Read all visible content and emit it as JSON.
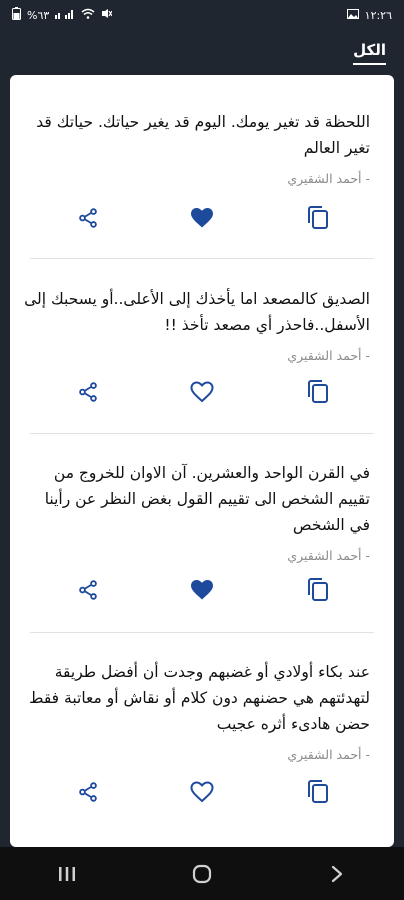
{
  "status_bar": {
    "time": "١٢:٢٦",
    "battery": "%٦٣"
  },
  "header": {
    "tab_label": "الكل"
  },
  "quotes": [
    {
      "text": "اللحظة قد تغير يومك. اليوم قد يغير حياتك. حياتك قد تغير العالم",
      "author": "- أحمد الشقيري",
      "liked": true
    },
    {
      "text": "الصديق كالمصعد اما يأخذك إلى الأعلى..أو يسحبك إلى الأسفل..فاحذر أي مصعد تأخذ !!",
      "author": "- أحمد الشقيري",
      "liked": false
    },
    {
      "text": "في القرن الواحد والعشرين. آن الاوان للخروج من تقييم الشخص الى تقييم القول بغض النظر عن رأينا في الشخص",
      "author": "- أحمد الشقيري",
      "liked": true
    },
    {
      "text": "عند بكاء أولادي أو غضبهم وجدت أن أفضل طريقة لتهدئتهم هي حضنهم دون كلام أو نقاش أو معاتبة فقط حضن هادىء أثره عجيب",
      "author": "- أحمد الشقيري",
      "liked": false
    }
  ],
  "colors": {
    "accent": "#1e4a9c",
    "background": "#1f2630",
    "card": "#ffffff"
  },
  "icons": {
    "share": "share-icon",
    "like": "heart-icon",
    "copy": "copy-icon"
  }
}
